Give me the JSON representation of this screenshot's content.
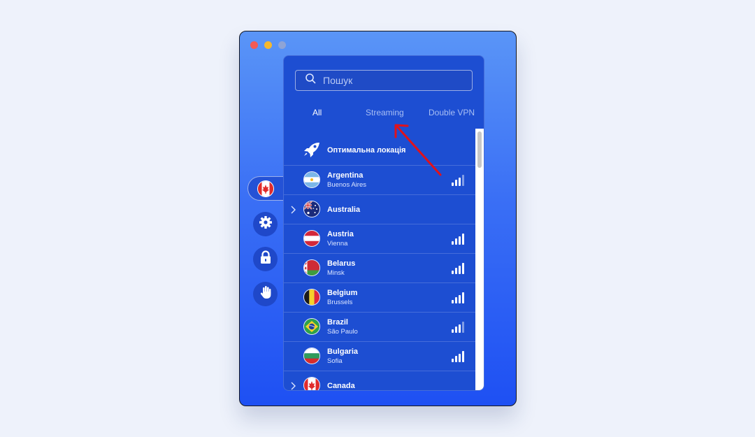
{
  "search": {
    "placeholder": "Пошук"
  },
  "tabs": [
    {
      "label": "All",
      "active": true
    },
    {
      "label": "Streaming",
      "active": false
    },
    {
      "label": "Double VPN",
      "active": false
    }
  ],
  "optimal": {
    "label": "Оптимальна локація",
    "icon": "rocket-icon"
  },
  "locations": [
    {
      "country": "Argentina",
      "city": "Buenos Aires",
      "flag": "argentina-flag-icon",
      "signal_level": 3,
      "expandable": false
    },
    {
      "country": "Australia",
      "city": "",
      "flag": "australia-flag-icon",
      "signal_level": null,
      "expandable": true
    },
    {
      "country": "Austria",
      "city": "Vienna",
      "flag": "austria-flag-icon",
      "signal_level": 4,
      "expandable": false
    },
    {
      "country": "Belarus",
      "city": "Minsk",
      "flag": "belarus-flag-icon",
      "signal_level": 4,
      "expandable": false
    },
    {
      "country": "Belgium",
      "city": "Brussels",
      "flag": "belgium-flag-icon",
      "signal_level": 4,
      "expandable": false
    },
    {
      "country": "Brazil",
      "city": "São Paulo",
      "flag": "brazil-flag-icon",
      "signal_level": 3,
      "expandable": false
    },
    {
      "country": "Bulgaria",
      "city": "Sofia",
      "flag": "bulgaria-flag-icon",
      "signal_level": 4,
      "expandable": false
    },
    {
      "country": "Canada",
      "city": "",
      "flag": "canada-flag-icon",
      "signal_level": null,
      "expandable": true
    }
  ],
  "sidebar": [
    {
      "icon": "canada-flag-icon",
      "active": true
    },
    {
      "icon": "gear-icon",
      "active": false
    },
    {
      "icon": "lock-icon",
      "active": false
    },
    {
      "icon": "hand-icon",
      "active": false
    }
  ],
  "colors": {
    "accent": "#1d4ed2",
    "annotation_arrow": "#e0121c"
  }
}
